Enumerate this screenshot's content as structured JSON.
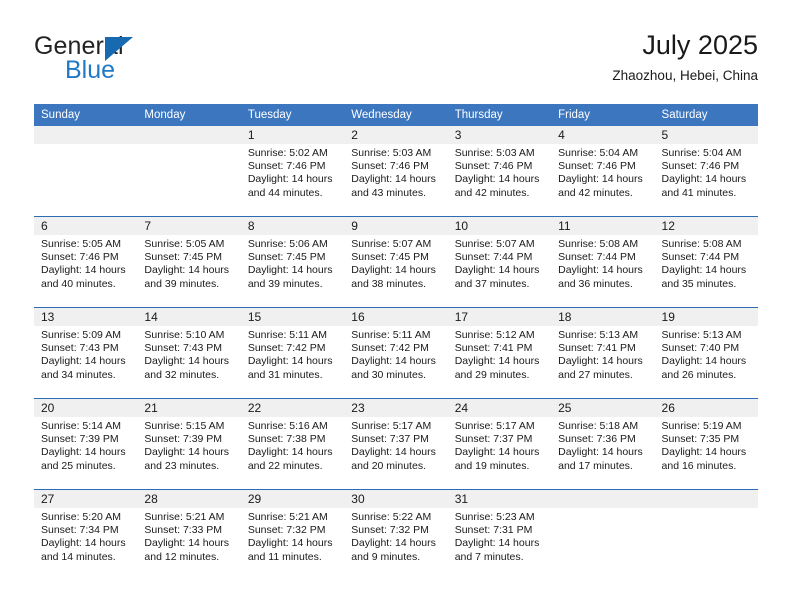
{
  "brand": {
    "name_part1": "General",
    "name_part2": "Blue",
    "triangle_color": "#1769b0",
    "blue_color": "#1f79c4"
  },
  "header": {
    "title": "July 2025",
    "location": "Zhaozhou, Hebei, China"
  },
  "theme": {
    "header_blue": "#3b76bf",
    "row_separator": "#2b6cb5",
    "daynum_band": "#f0f0f0"
  },
  "weekday_headers": [
    "Sunday",
    "Monday",
    "Tuesday",
    "Wednesday",
    "Thursday",
    "Friday",
    "Saturday"
  ],
  "weeks": [
    [
      {
        "day": "",
        "sunrise": "",
        "sunset": "",
        "daylight_line1": "",
        "daylight_line2": ""
      },
      {
        "day": "",
        "sunrise": "",
        "sunset": "",
        "daylight_line1": "",
        "daylight_line2": ""
      },
      {
        "day": "1",
        "sunrise": "Sunrise: 5:02 AM",
        "sunset": "Sunset: 7:46 PM",
        "daylight_line1": "Daylight: 14 hours",
        "daylight_line2": "and 44 minutes."
      },
      {
        "day": "2",
        "sunrise": "Sunrise: 5:03 AM",
        "sunset": "Sunset: 7:46 PM",
        "daylight_line1": "Daylight: 14 hours",
        "daylight_line2": "and 43 minutes."
      },
      {
        "day": "3",
        "sunrise": "Sunrise: 5:03 AM",
        "sunset": "Sunset: 7:46 PM",
        "daylight_line1": "Daylight: 14 hours",
        "daylight_line2": "and 42 minutes."
      },
      {
        "day": "4",
        "sunrise": "Sunrise: 5:04 AM",
        "sunset": "Sunset: 7:46 PM",
        "daylight_line1": "Daylight: 14 hours",
        "daylight_line2": "and 42 minutes."
      },
      {
        "day": "5",
        "sunrise": "Sunrise: 5:04 AM",
        "sunset": "Sunset: 7:46 PM",
        "daylight_line1": "Daylight: 14 hours",
        "daylight_line2": "and 41 minutes."
      }
    ],
    [
      {
        "day": "6",
        "sunrise": "Sunrise: 5:05 AM",
        "sunset": "Sunset: 7:46 PM",
        "daylight_line1": "Daylight: 14 hours",
        "daylight_line2": "and 40 minutes."
      },
      {
        "day": "7",
        "sunrise": "Sunrise: 5:05 AM",
        "sunset": "Sunset: 7:45 PM",
        "daylight_line1": "Daylight: 14 hours",
        "daylight_line2": "and 39 minutes."
      },
      {
        "day": "8",
        "sunrise": "Sunrise: 5:06 AM",
        "sunset": "Sunset: 7:45 PM",
        "daylight_line1": "Daylight: 14 hours",
        "daylight_line2": "and 39 minutes."
      },
      {
        "day": "9",
        "sunrise": "Sunrise: 5:07 AM",
        "sunset": "Sunset: 7:45 PM",
        "daylight_line1": "Daylight: 14 hours",
        "daylight_line2": "and 38 minutes."
      },
      {
        "day": "10",
        "sunrise": "Sunrise: 5:07 AM",
        "sunset": "Sunset: 7:44 PM",
        "daylight_line1": "Daylight: 14 hours",
        "daylight_line2": "and 37 minutes."
      },
      {
        "day": "11",
        "sunrise": "Sunrise: 5:08 AM",
        "sunset": "Sunset: 7:44 PM",
        "daylight_line1": "Daylight: 14 hours",
        "daylight_line2": "and 36 minutes."
      },
      {
        "day": "12",
        "sunrise": "Sunrise: 5:08 AM",
        "sunset": "Sunset: 7:44 PM",
        "daylight_line1": "Daylight: 14 hours",
        "daylight_line2": "and 35 minutes."
      }
    ],
    [
      {
        "day": "13",
        "sunrise": "Sunrise: 5:09 AM",
        "sunset": "Sunset: 7:43 PM",
        "daylight_line1": "Daylight: 14 hours",
        "daylight_line2": "and 34 minutes."
      },
      {
        "day": "14",
        "sunrise": "Sunrise: 5:10 AM",
        "sunset": "Sunset: 7:43 PM",
        "daylight_line1": "Daylight: 14 hours",
        "daylight_line2": "and 32 minutes."
      },
      {
        "day": "15",
        "sunrise": "Sunrise: 5:11 AM",
        "sunset": "Sunset: 7:42 PM",
        "daylight_line1": "Daylight: 14 hours",
        "daylight_line2": "and 31 minutes."
      },
      {
        "day": "16",
        "sunrise": "Sunrise: 5:11 AM",
        "sunset": "Sunset: 7:42 PM",
        "daylight_line1": "Daylight: 14 hours",
        "daylight_line2": "and 30 minutes."
      },
      {
        "day": "17",
        "sunrise": "Sunrise: 5:12 AM",
        "sunset": "Sunset: 7:41 PM",
        "daylight_line1": "Daylight: 14 hours",
        "daylight_line2": "and 29 minutes."
      },
      {
        "day": "18",
        "sunrise": "Sunrise: 5:13 AM",
        "sunset": "Sunset: 7:41 PM",
        "daylight_line1": "Daylight: 14 hours",
        "daylight_line2": "and 27 minutes."
      },
      {
        "day": "19",
        "sunrise": "Sunrise: 5:13 AM",
        "sunset": "Sunset: 7:40 PM",
        "daylight_line1": "Daylight: 14 hours",
        "daylight_line2": "and 26 minutes."
      }
    ],
    [
      {
        "day": "20",
        "sunrise": "Sunrise: 5:14 AM",
        "sunset": "Sunset: 7:39 PM",
        "daylight_line1": "Daylight: 14 hours",
        "daylight_line2": "and 25 minutes."
      },
      {
        "day": "21",
        "sunrise": "Sunrise: 5:15 AM",
        "sunset": "Sunset: 7:39 PM",
        "daylight_line1": "Daylight: 14 hours",
        "daylight_line2": "and 23 minutes."
      },
      {
        "day": "22",
        "sunrise": "Sunrise: 5:16 AM",
        "sunset": "Sunset: 7:38 PM",
        "daylight_line1": "Daylight: 14 hours",
        "daylight_line2": "and 22 minutes."
      },
      {
        "day": "23",
        "sunrise": "Sunrise: 5:17 AM",
        "sunset": "Sunset: 7:37 PM",
        "daylight_line1": "Daylight: 14 hours",
        "daylight_line2": "and 20 minutes."
      },
      {
        "day": "24",
        "sunrise": "Sunrise: 5:17 AM",
        "sunset": "Sunset: 7:37 PM",
        "daylight_line1": "Daylight: 14 hours",
        "daylight_line2": "and 19 minutes."
      },
      {
        "day": "25",
        "sunrise": "Sunrise: 5:18 AM",
        "sunset": "Sunset: 7:36 PM",
        "daylight_line1": "Daylight: 14 hours",
        "daylight_line2": "and 17 minutes."
      },
      {
        "day": "26",
        "sunrise": "Sunrise: 5:19 AM",
        "sunset": "Sunset: 7:35 PM",
        "daylight_line1": "Daylight: 14 hours",
        "daylight_line2": "and 16 minutes."
      }
    ],
    [
      {
        "day": "27",
        "sunrise": "Sunrise: 5:20 AM",
        "sunset": "Sunset: 7:34 PM",
        "daylight_line1": "Daylight: 14 hours",
        "daylight_line2": "and 14 minutes."
      },
      {
        "day": "28",
        "sunrise": "Sunrise: 5:21 AM",
        "sunset": "Sunset: 7:33 PM",
        "daylight_line1": "Daylight: 14 hours",
        "daylight_line2": "and 12 minutes."
      },
      {
        "day": "29",
        "sunrise": "Sunrise: 5:21 AM",
        "sunset": "Sunset: 7:32 PM",
        "daylight_line1": "Daylight: 14 hours",
        "daylight_line2": "and 11 minutes."
      },
      {
        "day": "30",
        "sunrise": "Sunrise: 5:22 AM",
        "sunset": "Sunset: 7:32 PM",
        "daylight_line1": "Daylight: 14 hours",
        "daylight_line2": "and 9 minutes."
      },
      {
        "day": "31",
        "sunrise": "Sunrise: 5:23 AM",
        "sunset": "Sunset: 7:31 PM",
        "daylight_line1": "Daylight: 14 hours",
        "daylight_line2": "and 7 minutes."
      },
      {
        "day": "",
        "sunrise": "",
        "sunset": "",
        "daylight_line1": "",
        "daylight_line2": ""
      },
      {
        "day": "",
        "sunrise": "",
        "sunset": "",
        "daylight_line1": "",
        "daylight_line2": ""
      }
    ]
  ]
}
